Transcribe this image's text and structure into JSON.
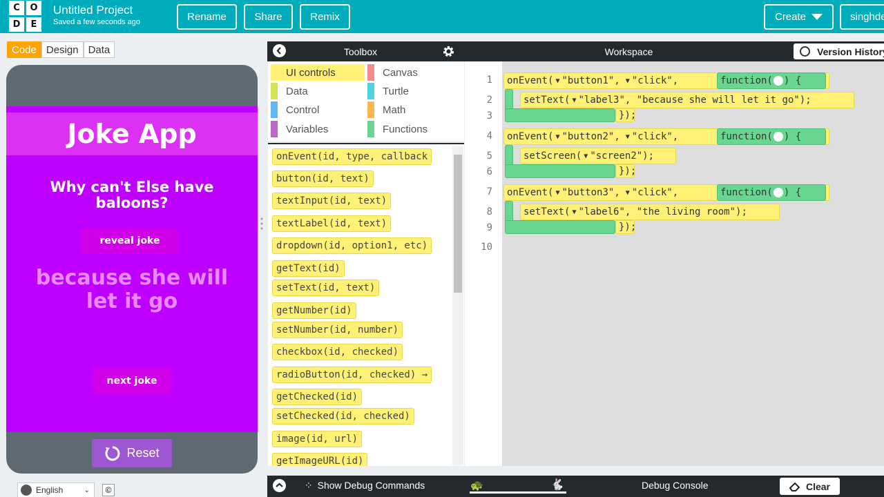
{
  "header": {
    "logo_letters": [
      "C",
      "O",
      "D",
      "E"
    ],
    "project_title": "Untitled Project",
    "saved_status": "Saved a few seconds ago",
    "buttons": {
      "rename": "Rename",
      "share": "Share",
      "remix": "Remix",
      "create": "Create",
      "user": "singhde"
    },
    "bg_color": "#00adbc"
  },
  "mode_tabs": {
    "code": "Code",
    "design": "Design",
    "data": "Data"
  },
  "app_preview": {
    "title": "Joke App",
    "question": "Why can't Else have baloons?",
    "reveal_button": "reveal joke",
    "answer": "because she will let it go",
    "next_button": "next joke",
    "reset_label": "Reset",
    "screen_color": "#bd00ff"
  },
  "footer": {
    "language": "English",
    "copyright_icon": "©"
  },
  "toolbox": {
    "title": "Toolbox",
    "categories": [
      {
        "label": "UI controls",
        "color": "#fff176"
      },
      {
        "label": "Canvas",
        "color": "#f28b8b"
      },
      {
        "label": "Data",
        "color": "#d4e157"
      },
      {
        "label": "Turtle",
        "color": "#4fd3e0"
      },
      {
        "label": "Control",
        "color": "#64b5f6"
      },
      {
        "label": "Math",
        "color": "#ffb74d"
      },
      {
        "label": "Variables",
        "color": "#ba68c8"
      },
      {
        "label": "Functions",
        "color": "#68d690"
      }
    ],
    "blocks": [
      "onEvent(id, type, callback",
      "button(id, text)",
      "textInput(id, text)",
      "textLabel(id, text)",
      "dropdown(id, option1, etc)",
      "getText(id)",
      "setText(id, text)",
      "getNumber(id)",
      "setNumber(id, number)",
      "checkbox(id, checked)",
      "radioButton(id, checked) →",
      "getChecked(id)",
      "setChecked(id, checked)",
      "image(id, url)",
      "getImageURL(id)"
    ]
  },
  "workspace": {
    "title": "Workspace",
    "version_history": "Version History",
    "line_numbers": [
      "1",
      "2",
      "3",
      "4",
      "5",
      "6",
      "7",
      "8",
      "9",
      "10"
    ],
    "events": [
      {
        "on_event": "onEvent(",
        "id": "\"button1\",",
        "type": "\"click\",",
        "function": "function(",
        "fn_tail": ") {",
        "call": "setText(",
        "call_args": "\"label3\",  \"because she will let it go\");",
        "close": "});"
      },
      {
        "on_event": "onEvent(",
        "id": "\"button2\",",
        "type": "\"click\",",
        "function": "function(",
        "fn_tail": ") {",
        "call": "setScreen(",
        "call_args": "\"screen2\");",
        "close": "});"
      },
      {
        "on_event": "onEvent(",
        "id": "\"button3\",",
        "type": "\"click\",",
        "function": "function(",
        "fn_tail": ") {",
        "call": "setText(",
        "call_args": "\"label6\",  \"the living room\");",
        "close": "});"
      }
    ]
  },
  "bottom_bar": {
    "show_debug": "Show Debug Commands",
    "debug_console": "Debug Console",
    "clear": "Clear"
  }
}
